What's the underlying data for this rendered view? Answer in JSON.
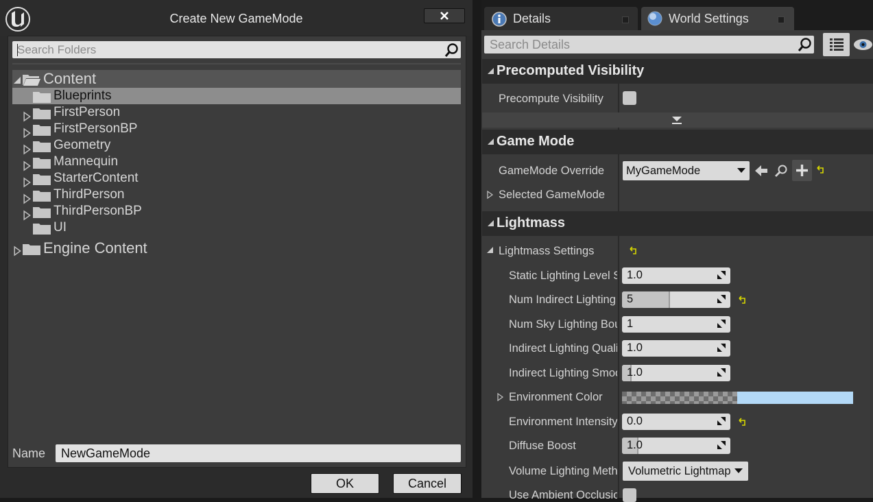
{
  "dialog": {
    "title": "Create New GameMode",
    "search_placeholder": "Search Folders",
    "tree": {
      "root": "Content",
      "items": [
        "Blueprints",
        "FirstPerson",
        "FirstPersonBP",
        "Geometry",
        "Mannequin",
        "StarterContent",
        "ThirdPerson",
        "ThirdPersonBP",
        "UI"
      ],
      "engine": "Engine Content"
    },
    "name_label": "Name",
    "name_value": "NewGameMode",
    "ok_label": "OK",
    "cancel_label": "Cancel"
  },
  "panel": {
    "tabs": [
      "Details",
      "World Settings"
    ],
    "search_placeholder": "Search Details",
    "categories": {
      "precomputed": "Precomputed Visibility",
      "gamemode": "Game Mode",
      "lightmass": "Lightmass"
    },
    "props": {
      "precompute_visibility": "Precompute Visibility",
      "gamemode_override": "GameMode Override",
      "gamemode_override_value": "MyGameMode",
      "selected_gamemode": "Selected GameMode",
      "lightmass_settings": "Lightmass Settings",
      "static_level_scale": "Static Lighting Level S",
      "static_level_scale_value": "1.0",
      "num_indirect": "Num Indirect Lighting",
      "num_indirect_value": "5",
      "num_sky": "Num Sky Lighting Bou",
      "num_sky_value": "1",
      "indirect_quality": "Indirect Lighting Quali",
      "indirect_quality_value": "1.0",
      "indirect_smooth": "Indirect Lighting Smoo",
      "indirect_smooth_value": "1.0",
      "env_color": "Environment Color",
      "env_intensity": "Environment Intensity",
      "env_intensity_value": "0.0",
      "diffuse_boost": "Diffuse Boost",
      "diffuse_boost_value": "1.0",
      "volume_method": "Volume Lighting Metho",
      "volume_method_value": "Volumetric Lightmap",
      "ambient_occlusion": "Use Ambient Occlusion"
    }
  },
  "colors": {
    "env_color": "#b3d9f7",
    "reset_arrow": "#d8d800"
  }
}
